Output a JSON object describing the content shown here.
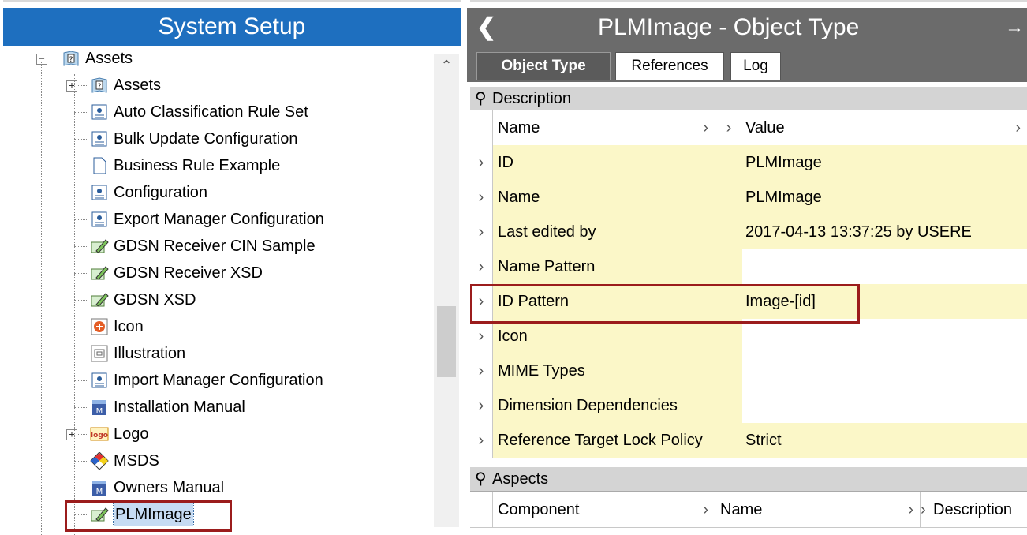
{
  "left_panel": {
    "title": "System Setup",
    "tree": [
      {
        "label": "Assets",
        "icon": "help-book-icon",
        "expandable": true
      },
      {
        "label": "Assets",
        "icon": "help-book-icon",
        "expandable": true
      },
      {
        "label": "Auto Classification Rule Set",
        "icon": "config-document-icon"
      },
      {
        "label": "Bulk Update Configuration",
        "icon": "config-document-icon"
      },
      {
        "label": "Business Rule Example",
        "icon": "blank-document-icon"
      },
      {
        "label": "Configuration",
        "icon": "config-document-icon"
      },
      {
        "label": "Export Manager Configuration",
        "icon": "config-document-icon"
      },
      {
        "label": "GDSN Receiver CIN Sample",
        "icon": "edit-image-icon"
      },
      {
        "label": "GDSN Receiver XSD",
        "icon": "edit-image-icon"
      },
      {
        "label": "GDSN XSD",
        "icon": "edit-image-icon"
      },
      {
        "label": "Icon",
        "icon": "red-plus-icon"
      },
      {
        "label": "Illustration",
        "icon": "illustration-icon"
      },
      {
        "label": "Import Manager Configuration",
        "icon": "config-document-icon"
      },
      {
        "label": "Installation Manual",
        "icon": "manual-book-icon"
      },
      {
        "label": "Logo",
        "icon": "logo-icon",
        "expandable": true
      },
      {
        "label": "MSDS",
        "icon": "hazard-diamond-icon"
      },
      {
        "label": "Owners Manual",
        "icon": "manual-book-icon"
      },
      {
        "label": "PLMImage",
        "icon": "edit-image-icon",
        "selected": true
      }
    ]
  },
  "right_panel": {
    "title": "PLMImage - Object Type",
    "tabs": [
      {
        "label": "Object Type",
        "active": true
      },
      {
        "label": "References"
      },
      {
        "label": "Log"
      }
    ],
    "description": {
      "section_title": "Description",
      "col_name": "Name",
      "col_value": "Value",
      "rows": [
        {
          "name": "ID",
          "value": "PLMImage"
        },
        {
          "name": "Name",
          "value": "PLMImage"
        },
        {
          "name": "Last edited by",
          "value": "2017-04-13 13:37:25 by USERE"
        },
        {
          "name": "Name Pattern",
          "value": ""
        },
        {
          "name": "ID Pattern",
          "value": "Image-[id]"
        },
        {
          "name": "Icon",
          "value": ""
        },
        {
          "name": "MIME Types",
          "value": ""
        },
        {
          "name": "Dimension Dependencies",
          "value": ""
        },
        {
          "name": "Reference Target Lock Policy",
          "value": "Strict"
        }
      ]
    },
    "aspects": {
      "section_title": "Aspects",
      "col_component": "Component",
      "col_name": "Name",
      "col_description": "Description"
    }
  },
  "colors": {
    "left_header": "#1e6fbf",
    "right_header": "#6b6b6b",
    "cell_yellow": "#fbf7c8",
    "highlight_box": "#9b1c1c"
  }
}
